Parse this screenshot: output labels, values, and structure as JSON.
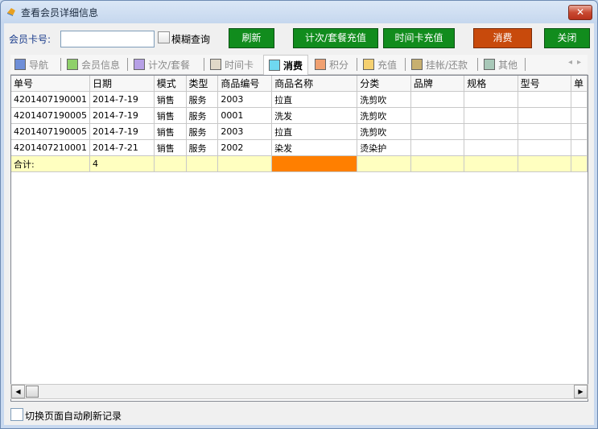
{
  "window": {
    "title": "查看会员详细信息",
    "close_label": "✕"
  },
  "search": {
    "card_label": "会员卡号:",
    "card_value": "",
    "fuzzy_label": "模糊查询"
  },
  "buttons": {
    "refresh": "刷新",
    "count_recharge": "计次/套餐充值",
    "time_recharge": "时间卡充值",
    "consume": "消费",
    "close": "关闭"
  },
  "colors": {
    "green_button": "#118c1d",
    "orange_button": "#c84a0c",
    "total_row": "#ffffc0",
    "highlight_cell": "#ff7f00"
  },
  "tabs": [
    {
      "label": "导航",
      "color": "#6f8fd8"
    },
    {
      "label": "会员信息",
      "color": "#8fd06a"
    },
    {
      "label": "计次/套餐",
      "color": "#b6a0e6"
    },
    {
      "label": "时间卡",
      "color": "#e0d8c8"
    },
    {
      "label": "消费",
      "color": "#6fd8f0",
      "active": true
    },
    {
      "label": "积分",
      "color": "#f0a070"
    },
    {
      "label": "充值",
      "color": "#f5d070"
    },
    {
      "label": "挂帐/还款",
      "color": "#c8b070"
    },
    {
      "label": "其他",
      "color": "#a8c8b8"
    }
  ],
  "table": {
    "columns": [
      "单号",
      "日期",
      "模式",
      "类型",
      "商品编号",
      "商品名称",
      "分类",
      "品牌",
      "规格",
      "型号",
      "单"
    ],
    "rows": [
      [
        "4201407190001",
        "2014-7-19",
        "销售",
        "服务",
        "2003",
        "拉直",
        "洗剪吹",
        "",
        "",
        "",
        ""
      ],
      [
        "4201407190005",
        "2014-7-19",
        "销售",
        "服务",
        "0001",
        "洗发",
        "洗剪吹",
        "",
        "",
        "",
        ""
      ],
      [
        "4201407190005",
        "2014-7-19",
        "销售",
        "服务",
        "2003",
        "拉直",
        "洗剪吹",
        "",
        "",
        "",
        ""
      ],
      [
        "4201407210001",
        "2014-7-21",
        "销售",
        "服务",
        "2002",
        "染发",
        "烫染护",
        "",
        "",
        "",
        ""
      ]
    ],
    "total": {
      "label": "合计:",
      "count": "4"
    }
  },
  "footer": {
    "auto_refresh_label": "切换页面自动刷新记录"
  }
}
